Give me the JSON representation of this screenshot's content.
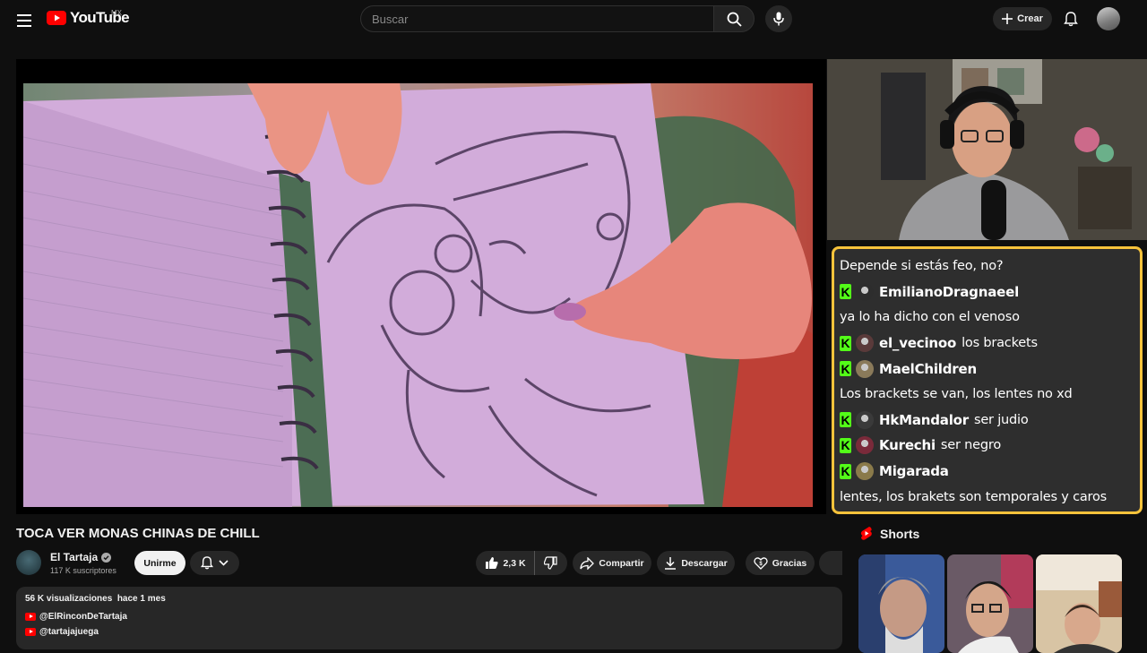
{
  "header": {
    "logo_text": "YouTube",
    "country_code": "MX",
    "search_placeholder": "Buscar",
    "create_label": "Crear"
  },
  "video": {
    "title": "TOCA VER MONAS CHINAS DE CHILL"
  },
  "chat": {
    "border_color": "#f7c33b",
    "badge_color": "#53fc18",
    "badge_letter": "K",
    "lines": [
      {
        "text": "Depende si estás feo, no?"
      },
      {
        "user": "EmilianoDragnaeel",
        "text": ""
      },
      {
        "text": "ya lo ha dicho con el venoso"
      },
      {
        "user": "el_vecinoo",
        "text": "los brackets"
      },
      {
        "user": "MaelChildren",
        "text": ""
      },
      {
        "text": "Los brackets se van, los lentes no xd"
      },
      {
        "user": "HkMandalor",
        "text": "ser judio"
      },
      {
        "user": "Kurechi",
        "text": "ser negro"
      },
      {
        "user": "Migarada",
        "text": ""
      },
      {
        "text": "lentes, los brakets son temporales y caros"
      }
    ]
  },
  "channel": {
    "name": "El Tartaja",
    "subscribers": "117 K suscriptores",
    "join_label": "Unirme"
  },
  "actions": {
    "likes": "2,3 K",
    "share_label": "Compartir",
    "download_label": "Descargar",
    "thanks_label": "Gracias"
  },
  "description": {
    "meta": "56 K visualizaciones  hace 1 mes",
    "links": [
      "@ElRinconDeTartaja",
      "@tartajajuega"
    ]
  },
  "shorts": {
    "title": "Shorts"
  },
  "colors": {
    "background": "#0f0f0f",
    "brand_red": "#ff0000"
  }
}
